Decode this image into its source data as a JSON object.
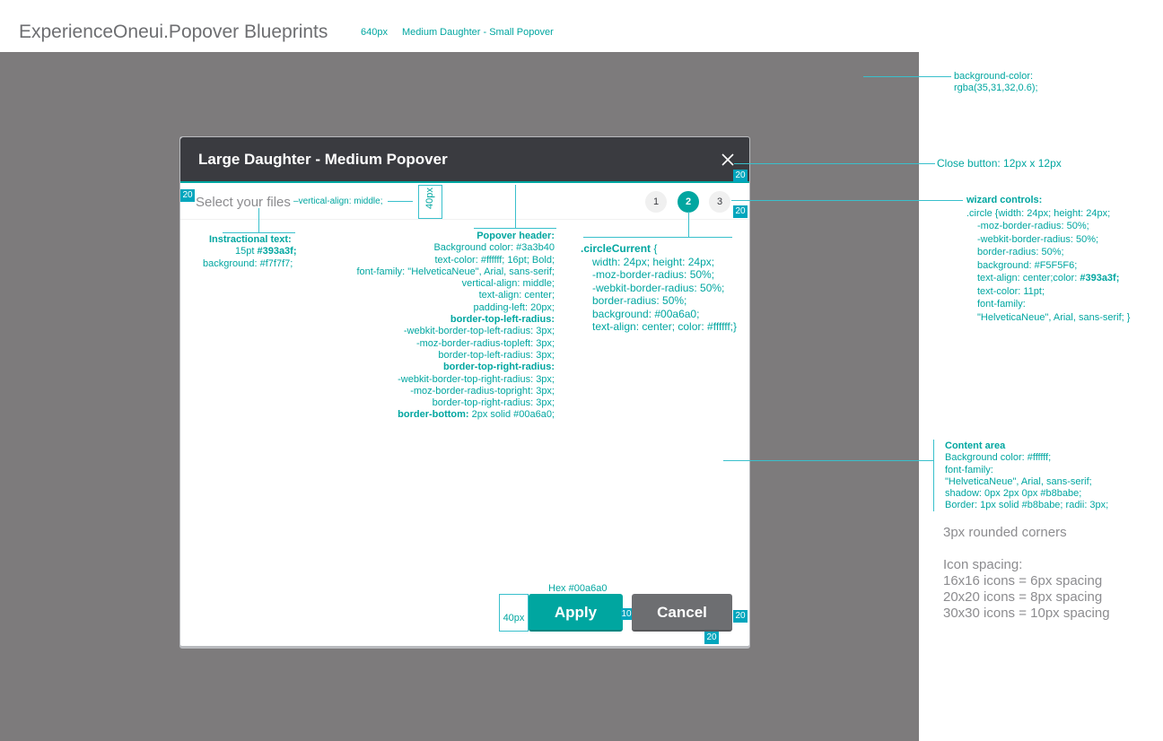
{
  "page": {
    "title": "ExperienceOneui.Popover Blueprints",
    "width_label": "640px",
    "variant_label": "Medium Daughter - Small Popover"
  },
  "popover": {
    "title": "Large Daughter - Medium Popover",
    "close_icon": "close-icon",
    "instruction": "Select your files",
    "steps": [
      "1",
      "2",
      "3"
    ],
    "current_step": 2,
    "apply_label": "Apply",
    "cancel_label": "Cancel"
  },
  "colors": {
    "overlay": "rgba(35,31,32,0.6)",
    "header": "#3a3b40",
    "accent": "#00a6a0",
    "button_secondary": "#6d6e71",
    "border": "#b8babe"
  },
  "annotations": {
    "overlay_bg": [
      "background-color:",
      "rgba(35,31,32,0.6);"
    ],
    "close_button": "Close button: 12px x 12px",
    "vertical_align": "vertical-align: middle;",
    "height_40_vertical": "40px",
    "height_40": "40px",
    "spacing_10": "10",
    "hex": "Hex #00a6a0",
    "tags": {
      "t20": "20"
    },
    "instructional": {
      "title": "Instractional text:",
      "size": "15pt ",
      "color": "#393a3f;",
      "background": "background: #f7f7f7;"
    },
    "popover_header": {
      "title": "Popover header:",
      "lines1": [
        "Background color: #3a3b40",
        "text-color: #ffffff; 16pt; Bold;",
        "font-family: \"HelveticaNeue\", Arial, sans-serif;",
        "vertical-align: middle;",
        "text-align: center;",
        "padding-left: 20px;"
      ],
      "tl_title": "border-top-left-radius:",
      "tl_lines": [
        "-webkit-border-top-left-radius: 3px;",
        "-moz-border-radius-topleft: 3px;",
        "border-top-left-radius: 3px;"
      ],
      "tr_title": "border-top-right-radius:",
      "tr_lines": [
        "-webkit-border-top-right-radius: 3px;",
        "-moz-border-radius-topright: 3px;",
        "border-top-right-radius: 3px;"
      ],
      "bb_title": "border-bottom:",
      "bb_value": "2px solid #00a6a0;"
    },
    "circle_current": {
      "title": ".circleCurrent",
      "brace": " {",
      "lines": [
        "width: 24px; height: 24px;",
        "-moz-border-radius: 50%;",
        "-webkit-border-radius: 50%;",
        "border-radius: 50%;",
        "background: #00a6a0;",
        "text-align: center; color: #ffffff;}"
      ]
    },
    "wizard": {
      "title": "wizard controls:",
      "line0": ".circle {width: 24px; height: 24px;",
      "lines": [
        "-moz-border-radius: 50%;",
        "-webkit-border-radius: 50%;",
        "border-radius: 50%;",
        "background: #F5F5F6;"
      ],
      "align": "text-align: center;color: ",
      "align_color": "#393a3f;",
      "lines2": [
        "text-color: 11pt;",
        "font-family:",
        "\"HelveticaNeue\", Arial, sans-serif; }"
      ]
    },
    "content": {
      "title": "Content area",
      "lines": [
        "Background color: #ffffff;",
        "font-family:",
        "\"HelveticaNeue\", Arial, sans-serif;",
        "shadow: 0px 2px 0px #b8babe;",
        "Border: 1px solid #b8babe; radii: 3px;"
      ]
    },
    "notes": {
      "rounded": "3px rounded corners",
      "spacing_title": "Icon spacing:",
      "spacing": [
        "16x16 icons = 6px spacing",
        "20x20 icons = 8px spacing",
        "30x30 icons = 10px spacing"
      ]
    }
  }
}
